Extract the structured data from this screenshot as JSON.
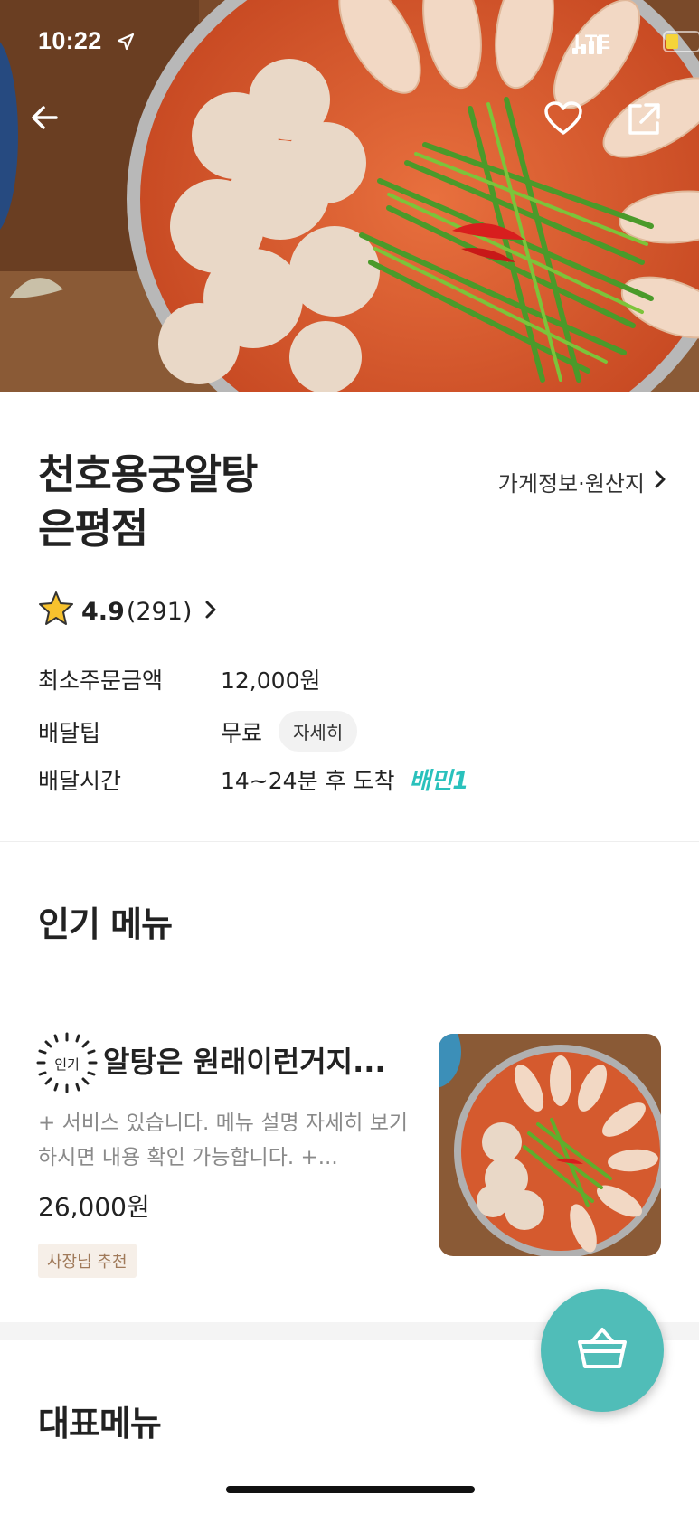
{
  "status_bar": {
    "time": "10:22",
    "network": "LTE"
  },
  "store": {
    "name_line1": "천호용궁알탕",
    "name_line2": "은평점",
    "info_link": "가게정보·원산지",
    "rating": {
      "score": "4.9",
      "count": "(291)"
    },
    "min_order": {
      "label": "최소주문금액",
      "value": "12,000원"
    },
    "delivery_tip": {
      "label": "배달팁",
      "value": "무료",
      "detail_button": "자세히"
    },
    "delivery_time": {
      "label": "배달시간",
      "value": "14~24분 후 도착",
      "badge": "배민1"
    }
  },
  "popular_section": {
    "title": "인기 메뉴",
    "badge": "인기",
    "item": {
      "name": "알탕은 원래이런거지...",
      "description": "+ 서비스 있습니다. 메뉴 설명 자세히 보기 하시면 내용 확인 가능합니다. +...",
      "price": "26,000원",
      "tag": "사장님 추천"
    }
  },
  "main_section": {
    "title": "대표메뉴"
  },
  "icons": {
    "back": "back-arrow-icon",
    "favorite": "heart-icon",
    "share": "share-icon",
    "cart": "cart-basket-icon",
    "rating": "star-icon"
  },
  "colors": {
    "brand_mint": "#50bdb8",
    "baemin_badge": "#2ac1bc",
    "tag_bg": "#f6efe8",
    "tag_text": "#a07a5a"
  }
}
